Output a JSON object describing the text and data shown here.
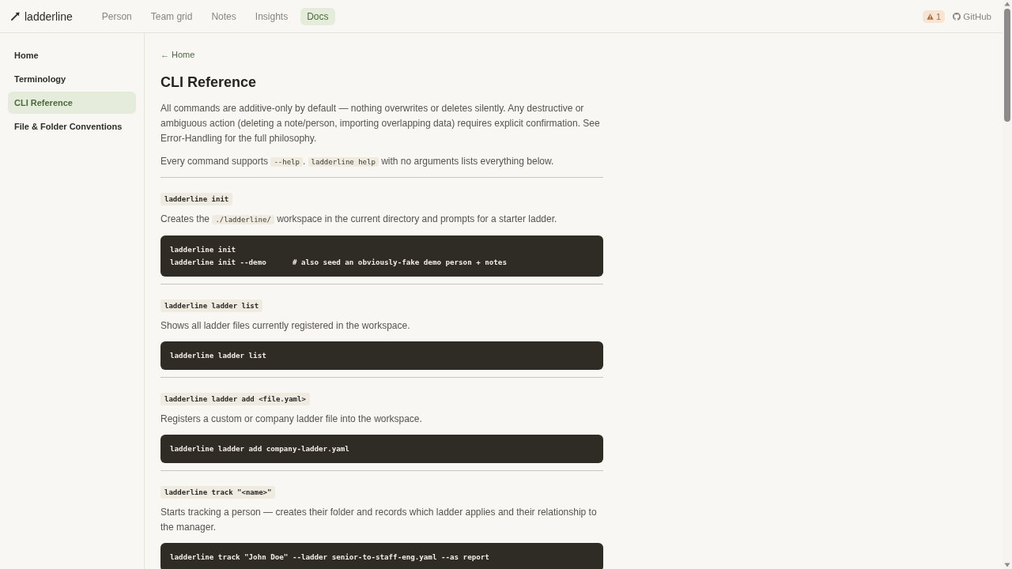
{
  "header": {
    "logo": "ladderline",
    "nav": [
      {
        "label": "Person",
        "selected": false
      },
      {
        "label": "Team grid",
        "selected": false
      },
      {
        "label": "Notes",
        "selected": false
      },
      {
        "label": "Insights",
        "selected": false
      },
      {
        "label": "Docs",
        "selected": true
      }
    ],
    "alert_count": "1",
    "github": "GitHub"
  },
  "sidebar": {
    "items": [
      {
        "label": "Home",
        "selected": false
      },
      {
        "label": "Terminology",
        "selected": false
      },
      {
        "label": "CLI Reference",
        "selected": true
      },
      {
        "label": "File & Folder Conventions",
        "selected": false
      }
    ]
  },
  "content": {
    "back_link": "← Home",
    "title": "CLI Reference",
    "paragraphs": [
      [
        {
          "kind": "text",
          "text": "All commands are additive-only by default — nothing overwrites or deletes silently. Any destructive or ambiguous action (deleting a note/person, importing overlapping data) requires explicit confirmation. See Error-Handling for the full philosophy."
        }
      ],
      [
        {
          "kind": "text",
          "text": "Every command supports "
        },
        {
          "kind": "code",
          "text": "--help"
        },
        {
          "kind": "text",
          "text": ". "
        },
        {
          "kind": "code",
          "text": "ladderline help"
        },
        {
          "kind": "text",
          "text": " with no arguments lists everything below."
        }
      ]
    ],
    "commands": [
      {
        "name": "ladderline init",
        "description": [
          {
            "kind": "text",
            "text": "Creates the "
          },
          {
            "kind": "code",
            "text": "./ladderline/"
          },
          {
            "kind": "text",
            "text": " workspace in the current directory and prompts for a starter ladder."
          }
        ],
        "code": [
          "ladderline init",
          "ladderline init --demo      # also seed an obviously-fake demo person + notes"
        ]
      },
      {
        "name": "ladderline ladder list",
        "description": [
          {
            "kind": "text",
            "text": "Shows all ladder files currently registered in the workspace."
          }
        ],
        "code": [
          "ladderline ladder list"
        ]
      },
      {
        "name": "ladderline ladder add <file.yaml>",
        "description": [
          {
            "kind": "text",
            "text": "Registers a custom or company ladder file into the workspace."
          }
        ],
        "code": [
          "ladderline ladder add company-ladder.yaml"
        ]
      },
      {
        "name": "ladderline track \"<name>\"",
        "description": [
          {
            "kind": "text",
            "text": "Starts tracking a person — creates their folder and records which ladder applies and their relationship to the manager."
          }
        ],
        "code": [
          "ladderline track \"John Doe\" --ladder senior-to-staff-eng.yaml --as report"
        ]
      }
    ]
  }
}
